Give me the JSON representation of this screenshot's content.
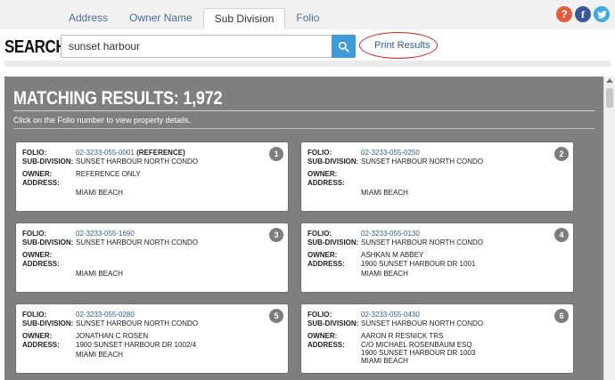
{
  "tabs": [
    {
      "label": "Address"
    },
    {
      "label": "Owner Name"
    },
    {
      "label": "Sub Division"
    },
    {
      "label": "Folio"
    }
  ],
  "social": {
    "help": "?",
    "facebook": "f",
    "twitter": "t"
  },
  "search": {
    "label": "SEARCH:",
    "value": "sunset harbour",
    "print_label": "Print Results"
  },
  "results": {
    "title": "MATCHING RESULTS: 1,972",
    "hint": "Click on the Folio number to view property details.",
    "labels": {
      "folio": "FOLIO:",
      "subdivision": "SUB-DIVISION:",
      "owner": "OWNER:",
      "address": "ADDRESS:"
    },
    "cards": [
      {
        "num": "1",
        "folio": "02-3233-055-0001",
        "note": " (REFERENCE)",
        "subdivision": "SUNSET HARBOUR NORTH CONDO",
        "owner": "REFERENCE ONLY",
        "addr1": "",
        "addr2": "",
        "city": "MIAMI BEACH"
      },
      {
        "num": "2",
        "folio": "02-3233-055-0250",
        "note": "",
        "subdivision": "SUNSET HARBOUR NORTH CONDO",
        "owner": "",
        "addr1": "",
        "addr2": "",
        "city": "MIAMI BEACH"
      },
      {
        "num": "3",
        "folio": "02-3233-055-1690",
        "note": "",
        "subdivision": "SUNSET HARBOUR NORTH CONDO",
        "owner": "",
        "addr1": "",
        "addr2": "",
        "city": "MIAMI BEACH"
      },
      {
        "num": "4",
        "folio": "02-3233-055-0130",
        "note": "",
        "subdivision": "SUNSET HARBOUR NORTH CONDO",
        "owner": "ASHKAN M ABBEY",
        "addr1": "1900 SUNSET HARBOUR DR 1001",
        "addr2": "",
        "city": "MIAMI BEACH"
      },
      {
        "num": "5",
        "folio": "02-3233-055-0280",
        "note": "",
        "subdivision": "SUNSET HARBOUR NORTH CONDO",
        "owner": "JONATHAN C ROSEN",
        "addr1": "1900 SUNSET HARBOUR DR 1002/4",
        "addr2": "",
        "city": "MIAMI BEACH"
      },
      {
        "num": "6",
        "folio": "02-3233-055-0430",
        "note": "",
        "subdivision": "SUNSET HARBOUR NORTH CONDO",
        "owner": "AARON R RESNICK TRS",
        "addr1": "C/O MICHAEL ROSENBAUM ESQ",
        "addr2": "1900 SUNSET HARBOUR DR 1003",
        "city": "MIAMI BEACH"
      }
    ]
  },
  "colors": {
    "accent": "#3c9bd8",
    "link": "#2b5c9e",
    "panel": "#7f7f7f",
    "highlight_ring": "#dd2222"
  }
}
